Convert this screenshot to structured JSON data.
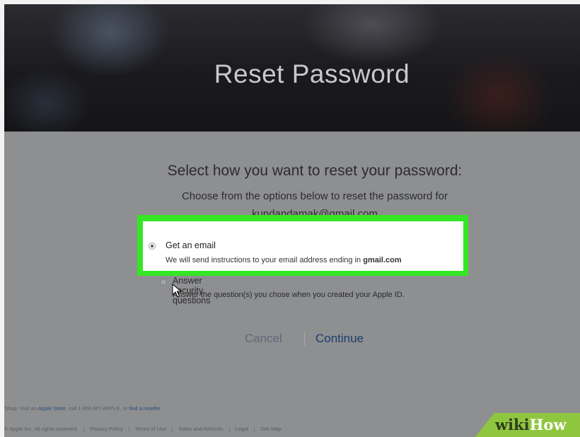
{
  "header": {
    "title": "Reset Password"
  },
  "main": {
    "heading": "Select how you want to reset your password:",
    "intro": "Choose from the options below to reset the password for",
    "email": "kundandamak@gmail.com",
    "options": [
      {
        "label": "Get an email",
        "description": "We will send instructions to your email address ending in",
        "description_emphasis": "gmail.com",
        "selected": true
      },
      {
        "label": "Answer security questions",
        "description": "Answer the question(s) you chose when you created your Apple ID.",
        "selected": false
      }
    ],
    "cancel_label": "Cancel",
    "continue_label": "Continue"
  },
  "footer": {
    "line1_prefix": "Shop: Visit an",
    "apple_store": "Apple Store",
    "line1_middle": ", call 1-800-MY-APPLE, or",
    "find_reseller": "find a reseller",
    "copyright": "© Apple Inc. All rights reserved.",
    "links": [
      "Privacy Policy",
      "Terms of Use",
      "Sales and Refunds",
      "Legal",
      "Site Map"
    ]
  },
  "watermark": {
    "part1": "wiki",
    "part2": "How"
  },
  "colors": {
    "highlight": "#34e624",
    "continue": "#1a3f6e",
    "brand": "#8fc63f"
  }
}
